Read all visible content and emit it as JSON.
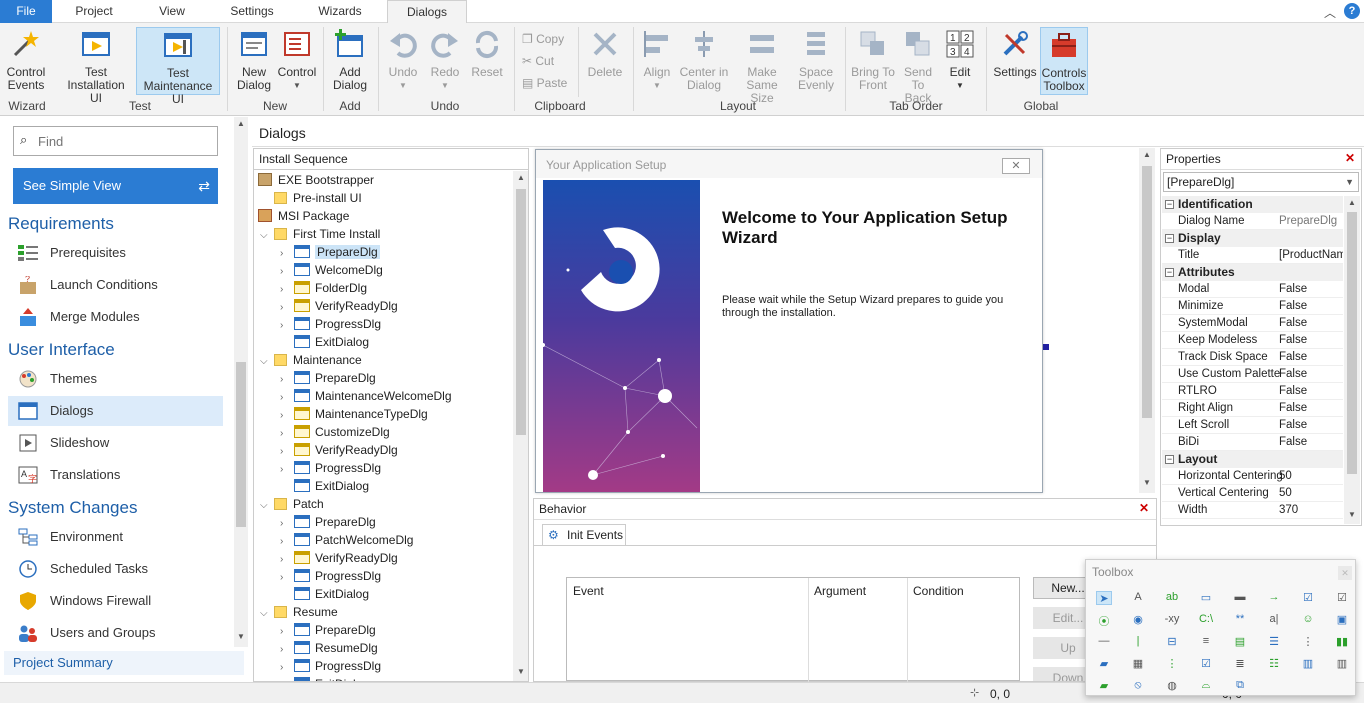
{
  "tabs": {
    "file": "File",
    "project": "Project",
    "view": "View",
    "settings": "Settings",
    "wizards": "Wizards",
    "dialogs": "Dialogs"
  },
  "ribbon": {
    "control_events": "Control Events",
    "test_install": "Test Installation UI",
    "test_maint": "Test Maintenance UI",
    "new_dialog": "New Dialog",
    "control": "Control",
    "add_dialog": "Add Dialog",
    "undo": "Undo",
    "redo": "Redo",
    "reset": "Reset",
    "copy": "Copy",
    "cut": "Cut",
    "paste": "Paste",
    "delete": "Delete",
    "align": "Align",
    "center": "Center in Dialog",
    "make_same": "Make Same Size",
    "space": "Space Evenly",
    "bring": "Bring To Front",
    "send": "Send To Back",
    "edit": "Edit",
    "settings": "Settings",
    "controls_toolbox": "Controls Toolbox",
    "groups": {
      "wizard": "Wizard",
      "test": "Test",
      "new": "New",
      "add": "Add",
      "undo": "Undo",
      "clipboard": "Clipboard",
      "layout": "Layout",
      "tab_order": "Tab Order",
      "global": "Global"
    }
  },
  "sidebar": {
    "find_placeholder": "Find",
    "simple_view": "See Simple View",
    "sections": {
      "requirements": "Requirements",
      "ui": "User Interface",
      "system": "System Changes"
    },
    "items": {
      "prereq": "Prerequisites",
      "launch": "Launch Conditions",
      "merge": "Merge Modules",
      "themes": "Themes",
      "dialogs": "Dialogs",
      "slideshow": "Slideshow",
      "translations": "Translations",
      "env": "Environment",
      "tasks": "Scheduled Tasks",
      "firewall": "Windows Firewall",
      "users": "Users and Groups"
    },
    "summary": "Project Summary"
  },
  "page_title": "Dialogs",
  "tree": {
    "header": "Install Sequence",
    "rows": [
      {
        "label": "EXE Bootstrapper"
      },
      {
        "label": "Pre-install UI"
      },
      {
        "label": "MSI Package"
      },
      {
        "label": "First Time Install"
      },
      {
        "label": "PrepareDlg"
      },
      {
        "label": "WelcomeDlg"
      },
      {
        "label": "FolderDlg"
      },
      {
        "label": "VerifyReadyDlg"
      },
      {
        "label": "ProgressDlg"
      },
      {
        "label": "ExitDialog"
      },
      {
        "label": "Maintenance"
      },
      {
        "label": "PrepareDlg"
      },
      {
        "label": "MaintenanceWelcomeDlg"
      },
      {
        "label": "MaintenanceTypeDlg"
      },
      {
        "label": "CustomizeDlg"
      },
      {
        "label": "VerifyReadyDlg"
      },
      {
        "label": "ProgressDlg"
      },
      {
        "label": "ExitDialog"
      },
      {
        "label": "Patch"
      },
      {
        "label": "PrepareDlg"
      },
      {
        "label": "PatchWelcomeDlg"
      },
      {
        "label": "VerifyReadyDlg"
      },
      {
        "label": "ProgressDlg"
      },
      {
        "label": "ExitDialog"
      },
      {
        "label": "Resume"
      },
      {
        "label": "PrepareDlg"
      },
      {
        "label": "ResumeDlg"
      },
      {
        "label": "ProgressDlg"
      },
      {
        "label": "ExitDial"
      }
    ]
  },
  "preview": {
    "window_title": "Your Application Setup",
    "heading": "Welcome to Your Application Setup Wizard",
    "body": "Please wait while the Setup Wizard prepares to guide you through the installation."
  },
  "behavior": {
    "title": "Behavior",
    "tab": "Init Events",
    "cols": {
      "event": "Event",
      "argument": "Argument",
      "condition": "Condition"
    },
    "new": "New...",
    "edit": "Edit...",
    "up": "Up",
    "down": "Down"
  },
  "properties": {
    "title": "Properties",
    "selected": "[PrepareDlg]",
    "cats": {
      "ident": "Identification",
      "display": "Display",
      "attrs": "Attributes",
      "layout": "Layout"
    },
    "rows": {
      "dialog_name": {
        "k": "Dialog Name",
        "v": "PrepareDlg"
      },
      "title": {
        "k": "Title",
        "v": "[ProductName]"
      },
      "modal": {
        "k": "Modal",
        "v": "False"
      },
      "minimize": {
        "k": "Minimize",
        "v": "False"
      },
      "system_modal": {
        "k": "SystemModal",
        "v": "False"
      },
      "keep_modeless": {
        "k": "Keep Modeless",
        "v": "False"
      },
      "track_disk": {
        "k": "Track Disk Space",
        "v": "False"
      },
      "custom_palette": {
        "k": "Use Custom Palette",
        "v": "False"
      },
      "rtlro": {
        "k": "RTLRO",
        "v": "False"
      },
      "right_align": {
        "k": "Right Align",
        "v": "False"
      },
      "left_scroll": {
        "k": "Left Scroll",
        "v": "False"
      },
      "bidi": {
        "k": "BiDi",
        "v": "False"
      },
      "hcenter": {
        "k": "Horizontal Centering",
        "v": "50"
      },
      "vcenter": {
        "k": "Vertical Centering",
        "v": "50"
      },
      "width": {
        "k": "Width",
        "v": "370"
      }
    }
  },
  "toolbox": {
    "title": "Toolbox"
  },
  "status": {
    "coords": "0, 0",
    "coords2": "0, 0"
  },
  "colors": {
    "accent": "#2b7cd3",
    "section": "#1e5fa8",
    "selected": "#dcebfa"
  }
}
